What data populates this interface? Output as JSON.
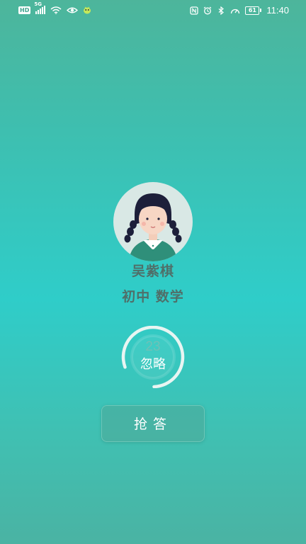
{
  "status_bar": {
    "left_icons": [
      "hd-icon",
      "signal-5g-icon",
      "wifi-icon",
      "eye-icon",
      "app-bird-icon"
    ],
    "hd_label": "HD",
    "network_label": "5G",
    "right_icons": [
      "nfc-icon",
      "alarm-icon",
      "bluetooth-icon",
      "speed-icon"
    ],
    "battery_level": "61",
    "time": "11:40"
  },
  "profile": {
    "name": "吴紫棋",
    "subject": "初中 数学"
  },
  "timer": {
    "countdown": "23",
    "progress": 0.8,
    "ignore_label": "忽略"
  },
  "actions": {
    "grab_label": "抢答"
  },
  "colors": {
    "background_top": "#4db59b",
    "background_mid": "#2fcdc9",
    "text_muted": "#4f6f69",
    "ring": "#e8f5f2"
  }
}
